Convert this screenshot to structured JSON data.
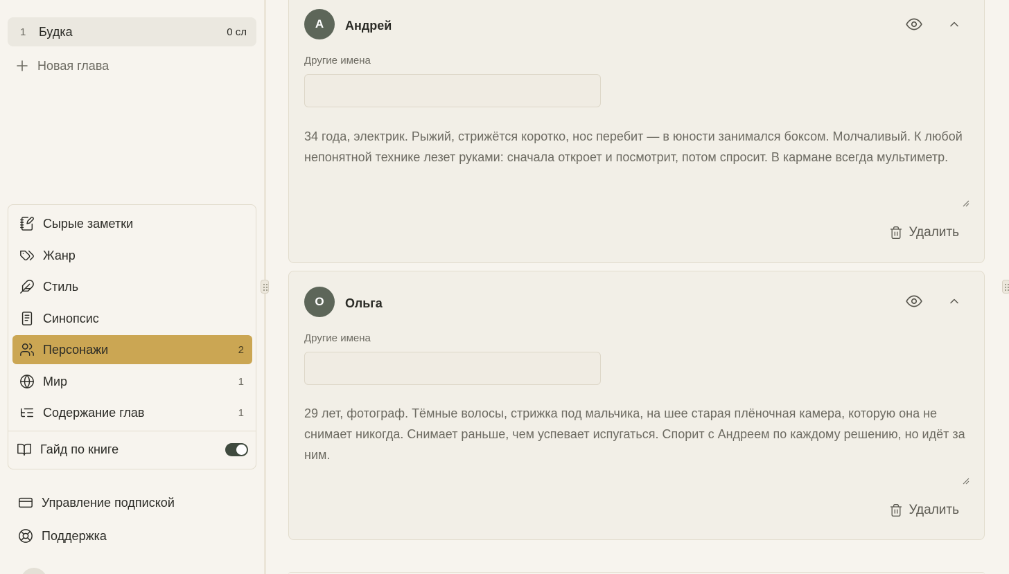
{
  "chapters": [
    {
      "number": "1",
      "title": "Будка",
      "words": "0 сл"
    }
  ],
  "new_chapter_label": "Новая глава",
  "nav": {
    "items": [
      {
        "label": "Сырые заметки",
        "icon": "notebook-pen-icon",
        "count": ""
      },
      {
        "label": "Жанр",
        "icon": "tags-icon",
        "count": ""
      },
      {
        "label": "Стиль",
        "icon": "feather-icon",
        "count": ""
      },
      {
        "label": "Синопсис",
        "icon": "document-icon",
        "count": ""
      },
      {
        "label": "Персонажи",
        "icon": "users-icon",
        "count": "2",
        "active": true
      },
      {
        "label": "Мир",
        "icon": "globe-icon",
        "count": "1"
      },
      {
        "label": "Содержание глав",
        "icon": "list-tree-icon",
        "count": "1"
      }
    ],
    "guide": {
      "label": "Гайд по книге",
      "enabled": true
    }
  },
  "bottom_links": {
    "subscription": "Управление подпиской",
    "support": "Поддержка"
  },
  "characters": [
    {
      "initial": "А",
      "name": "Андрей",
      "other_names_label": "Другие имена",
      "other_names_value": "",
      "description": "34 года, электрик. Рыжий, стрижётся коротко, нос перебит — в юности занимался боксом. Молчаливый. К любой непонятной технике лезет руками: сначала откроет и посмотрит, потом спросит. В кармане всегда мультиметр.",
      "delete_label": "Удалить"
    },
    {
      "initial": "О",
      "name": "Ольга",
      "other_names_label": "Другие имена",
      "other_names_value": "",
      "description": "29 лет, фотограф. Тёмные волосы, стрижка под мальчика, на шее старая плёночная камера, которую она не снимает никогда. Снимает раньше, чем успевает испугаться. Спорит с Андреем по каждому решению, но идёт за ним.",
      "delete_label": "Удалить"
    }
  ],
  "colors": {
    "background": "#f7f4ee",
    "card": "#f2efe7",
    "active_nav": "#cba653",
    "avatar": "#5d6659",
    "toggle_on": "#3f4a3e"
  }
}
